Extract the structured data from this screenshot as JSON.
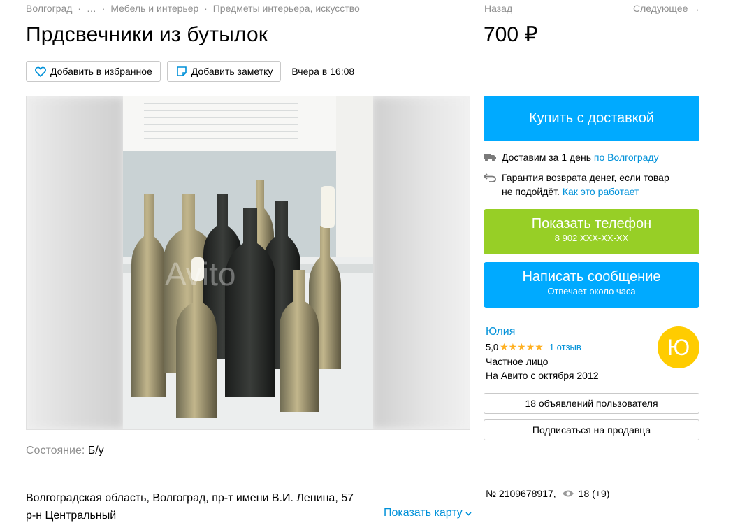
{
  "breadcrumbs": [
    "Волгоград",
    "…",
    "Мебель и интерьер",
    "Предметы интерьера, искусство"
  ],
  "title": "Прдсвечники из бутылок",
  "actions": {
    "favorite": "Добавить в избранное",
    "note": "Добавить заметку",
    "posted": "Вчера в 16:08"
  },
  "nav": {
    "back": "Назад",
    "next": "Следующее →"
  },
  "price": "700 ₽",
  "buy_label": "Купить с доставкой",
  "delivery": {
    "text": "Доставим за 1 день ",
    "link": "по Волгограду"
  },
  "guarantee": {
    "line1": "Гарантия возврата денег, если товар",
    "line2": "не подойдёт. ",
    "link": "Как это работает"
  },
  "phone": {
    "label": "Показать телефон",
    "number": "8 902 XXX-XX-XX"
  },
  "message": {
    "label": "Написать сообщение",
    "sub": "Отвечает около часа"
  },
  "seller": {
    "name": "Юлия",
    "rating": "5,0",
    "stars": "★★★★★",
    "reviews": "1 отзыв",
    "type": "Частное лицо",
    "since": "На Авито с октября 2012",
    "avatar_letter": "Ю"
  },
  "user_ads": "18 объявлений пользователя",
  "subscribe": "Подписаться на продавца",
  "condition": {
    "label": "Состояние:",
    "value": "Б/у"
  },
  "address": {
    "line1": "Волгоградская область, Волгоград, пр-т имени В.И. Ленина, 57",
    "line2": "р-н Центральный"
  },
  "map_link": "Показать карту",
  "listing": {
    "number": "№ 2109678917,",
    "views": "18 (+9)"
  },
  "colors": {
    "blue": "#00aaff",
    "green": "#97cf26",
    "link": "#0091d9",
    "star": "#ffb021",
    "avatar": "#ffcc00"
  },
  "watermark": "Avito"
}
